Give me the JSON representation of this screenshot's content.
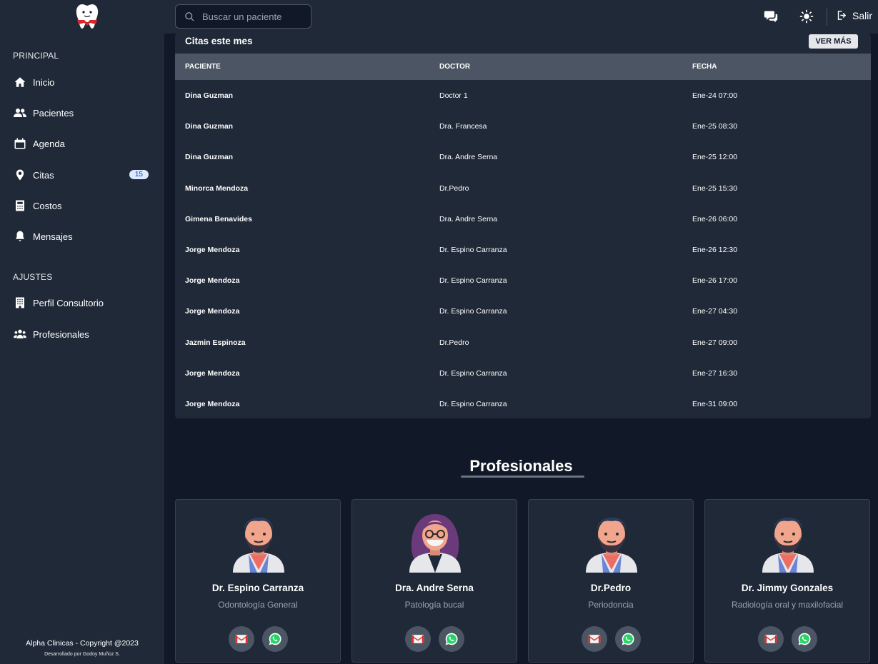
{
  "sidebar": {
    "section_principal": "PRINCIPAL",
    "items_principal": [
      {
        "label": "Inicio",
        "icon": "home-icon"
      },
      {
        "label": "Pacientes",
        "icon": "users-icon"
      },
      {
        "label": "Agenda",
        "icon": "calendar-icon"
      },
      {
        "label": "Citas",
        "icon": "map-pin-icon",
        "badge": "15"
      },
      {
        "label": "Costos",
        "icon": "calculator-icon"
      },
      {
        "label": "Mensajes",
        "icon": "bell-icon"
      }
    ],
    "section_ajustes": "AJUSTES",
    "items_ajustes": [
      {
        "label": "Perfil Consultorio",
        "icon": "building-icon"
      },
      {
        "label": "Profesionales",
        "icon": "user-group-icon"
      }
    ],
    "footer_copyright": "Alpha Clinicas - Copyright @2023",
    "footer_dev": "Desarrollado por Godoy Muñoz S."
  },
  "topbar": {
    "search_placeholder": "Buscar un paciente",
    "logout_label": "Salir"
  },
  "appointments": {
    "title": "Citas este mes",
    "button_label": "VER MÁS",
    "columns": [
      "PACIENTE",
      "DOCTOR",
      "FECHA"
    ],
    "rows": [
      [
        "Dina Guzman",
        "Doctor 1",
        "Ene-24 07:00"
      ],
      [
        "Dina Guzman",
        "Dra. Francesa",
        "Ene-25 08:30"
      ],
      [
        "Dina Guzman",
        "Dra. Andre Serna",
        "Ene-25 12:00"
      ],
      [
        "Minorca Mendoza",
        "Dr.Pedro",
        "Ene-25 15:30"
      ],
      [
        "Gimena Benavides",
        "Dra. Andre Serna",
        "Ene-26 06:00"
      ],
      [
        "Jorge Mendoza",
        "Dr. Espino Carranza",
        "Ene-26 12:30"
      ],
      [
        "Jorge Mendoza",
        "Dr. Espino Carranza",
        "Ene-26 17:00"
      ],
      [
        "Jorge Mendoza",
        "Dr. Espino Carranza",
        "Ene-27 04:30"
      ],
      [
        "Jazmin Espinoza",
        "Dr.Pedro",
        "Ene-27 09:00"
      ],
      [
        "Jorge Mendoza",
        "Dr. Espino Carranza",
        "Ene-27 16:30"
      ],
      [
        "Jorge Mendoza",
        "Dr. Espino Carranza",
        "Ene-31 09:00"
      ]
    ]
  },
  "professionals": {
    "title": "Profesionales",
    "cards": [
      {
        "name": "Dr. Espino Carranza",
        "specialty": "Odontología General",
        "avatar": "male-doctor-avatar"
      },
      {
        "name": "Dra. Andre Serna",
        "specialty": "Patología bucal",
        "avatar": "female-doctor-avatar"
      },
      {
        "name": "Dr.Pedro",
        "specialty": "Periodoncia",
        "avatar": "male-doctor-avatar"
      },
      {
        "name": "Dr. Jimmy Gonzales",
        "specialty": "Radiología oral y maxilofacial",
        "avatar": "male-doctor-avatar"
      }
    ]
  },
  "colors": {
    "sidebar_bg": "#1f2937",
    "main_bg": "#111827",
    "table_header_bg": "#4b5563",
    "badge_bg": "#dbeafe"
  }
}
